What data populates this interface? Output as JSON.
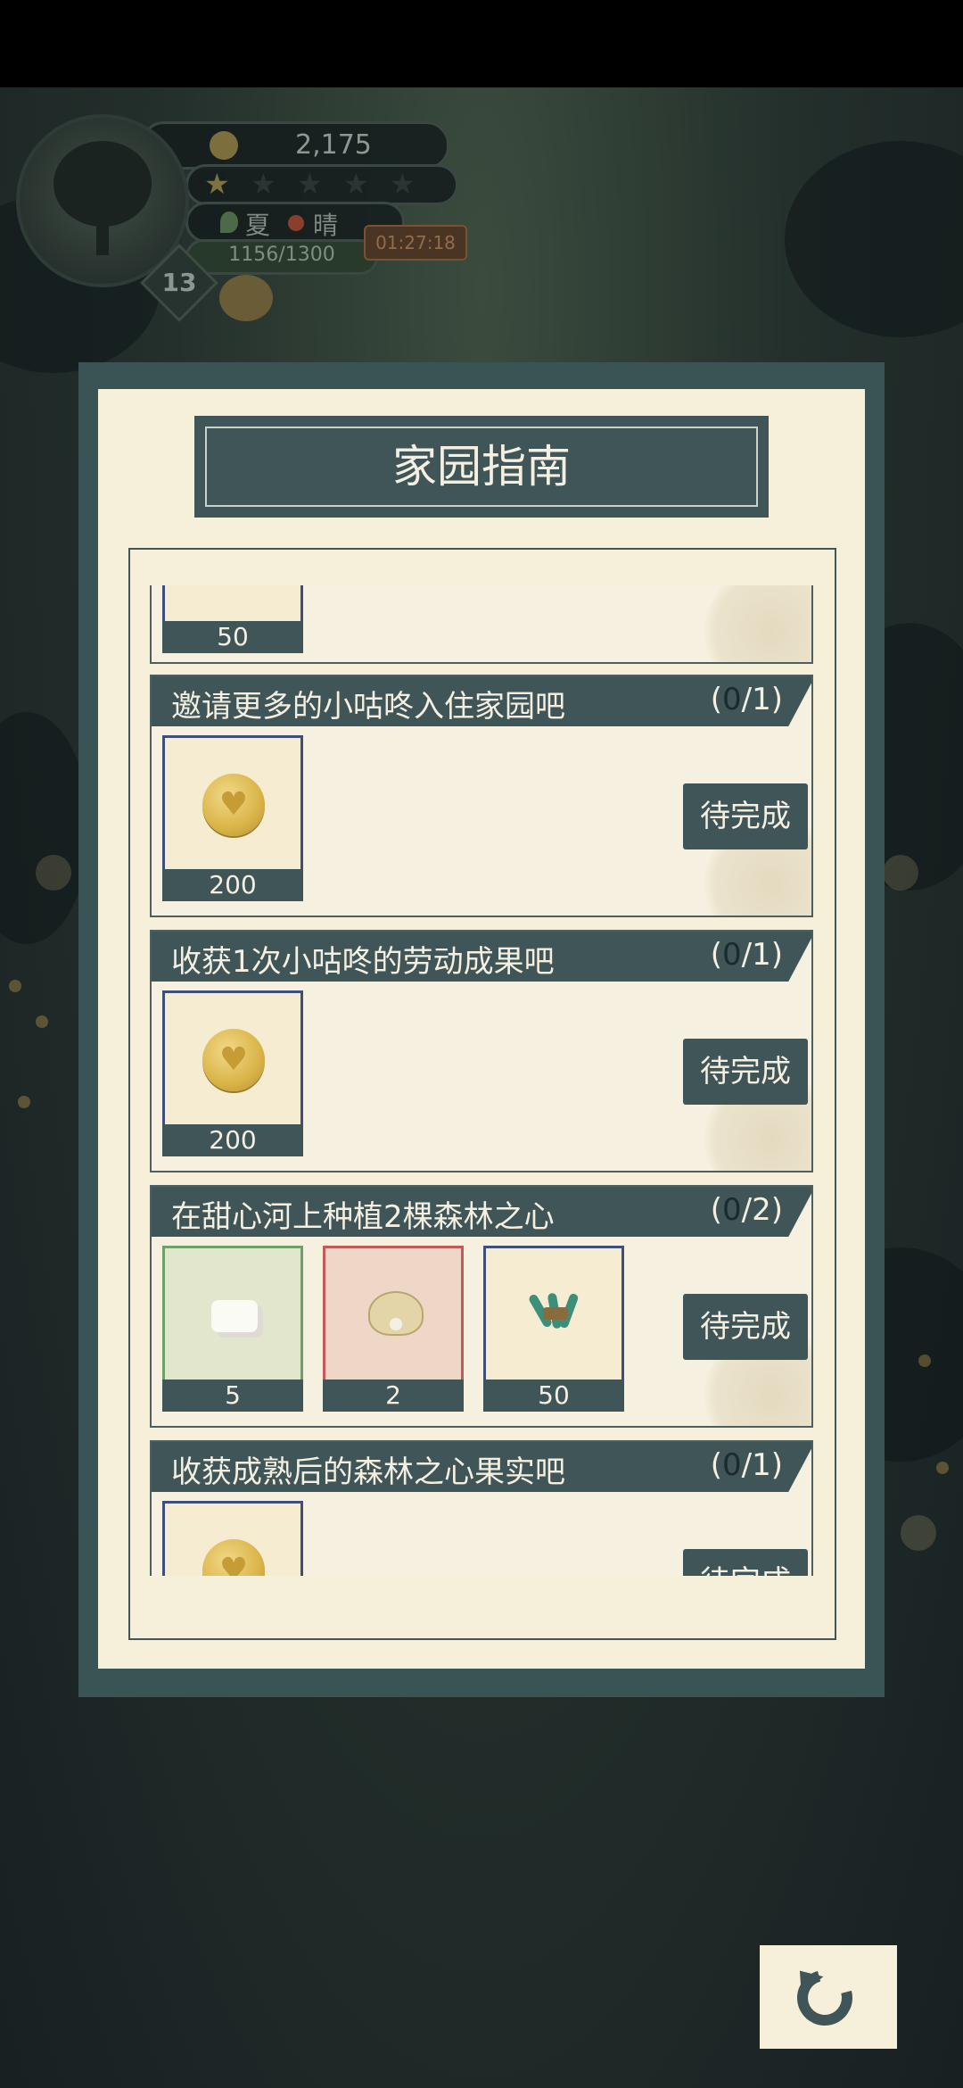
{
  "hud": {
    "coins": "2,175",
    "stars_total": 5,
    "stars_filled": 1,
    "season": "夏",
    "weather": "晴",
    "xp": "1156/1300",
    "timer": "01:27:18",
    "level": "13"
  },
  "dialog": {
    "title": "家园指南",
    "partial_card": {
      "amount": "50"
    },
    "tasks": [
      {
        "label": "邀请更多的小咕咚入住家园吧",
        "progress_open": "(",
        "progress_current": "0",
        "progress_close": "/1)",
        "rewards": [
          {
            "icon": "heart-coin-icon",
            "amount": "200"
          }
        ],
        "button": "待完成"
      },
      {
        "label": "收获1次小咕咚的劳动成果吧",
        "progress_open": "(",
        "progress_current": "0",
        "progress_close": "/1)",
        "rewards": [
          {
            "icon": "heart-coin-icon",
            "amount": "200"
          }
        ],
        "button": "待完成"
      },
      {
        "label": "在甜心河上种植2棵森林之心",
        "progress_open": "(",
        "progress_current": "0",
        "progress_close": "/2)",
        "rewards": [
          {
            "icon": "sugar-cube-icon",
            "amount": "5",
            "frame": "green"
          },
          {
            "icon": "pearl-shell-icon",
            "amount": "2",
            "frame": "red"
          },
          {
            "icon": "herb-bundle-icon",
            "amount": "50",
            "frame": "blue"
          }
        ],
        "button": "待完成"
      },
      {
        "label": "收获成熟后的森林之心果实吧",
        "progress_open": "(",
        "progress_current": "0",
        "progress_close": "/1)",
        "rewards": [
          {
            "icon": "heart-coin-icon",
            "amount": ""
          }
        ],
        "button": "待完成"
      }
    ]
  },
  "colors": {
    "panel": "#3f5557",
    "paper": "#f6efd9",
    "text_light": "#f4efe0"
  },
  "back_button": {
    "icon": "undo-arrow-icon"
  }
}
